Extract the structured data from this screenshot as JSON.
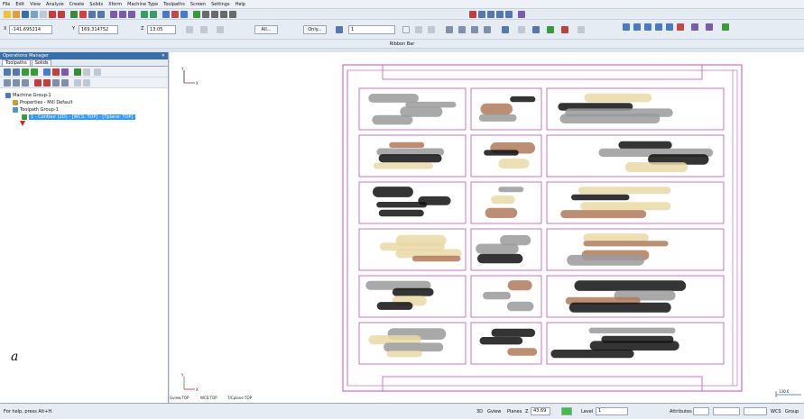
{
  "menu": [
    "File",
    "Edit",
    "View",
    "Analyze",
    "Create",
    "Solids",
    "Xform",
    "Machine Type",
    "Toolpaths",
    "Screen",
    "Settings",
    "Help"
  ],
  "toolbar": {
    "x_label": "X",
    "x_value": "-141.695214",
    "y_label": "Y",
    "y_value": "169.314752",
    "z_label": "Z",
    "z_value": "13.05",
    "all_label": "All...",
    "only_label": "Only...",
    "level_value": "1",
    "ribbon_label": "Ribbon Bar"
  },
  "panel": {
    "title": "Operations Manager",
    "tabs": [
      "Toolpaths",
      "Solids"
    ],
    "tree": [
      {
        "label": "Machine Group-1",
        "indent": 0,
        "selected": false
      },
      {
        "label": "Properties - Mill Default",
        "indent": 1,
        "selected": false
      },
      {
        "label": "Toolpath Group-1",
        "indent": 1,
        "selected": false
      },
      {
        "label": "1 - Contour (2D) - [WCS: TOP] - [Tplane: TOP]",
        "indent": 2,
        "selected": true
      }
    ],
    "figure_letter": "a"
  },
  "viewport": {
    "axis_x": "X",
    "axis_y": "Y",
    "bottom_info": [
      "Gview:TOP",
      "WCS:TOP",
      "T/Cplane:TOP"
    ],
    "scale_value": "130.6",
    "colors": {
      "frame": "#c04fc0",
      "black": "#111111",
      "gray": "#9a9a9a",
      "brown": "#b07a5a",
      "cream": "#e8d9a6"
    }
  },
  "status": {
    "help_text": "For help, press Alt+H.",
    "mode_3d": "3D",
    "gview": "Gview",
    "planes": "Planes",
    "z_label": "Z",
    "z_value": "43.69",
    "level_label": "Level",
    "level_value": "1",
    "attributes": "Attributes",
    "wcs": "WCS",
    "group": "Group"
  }
}
